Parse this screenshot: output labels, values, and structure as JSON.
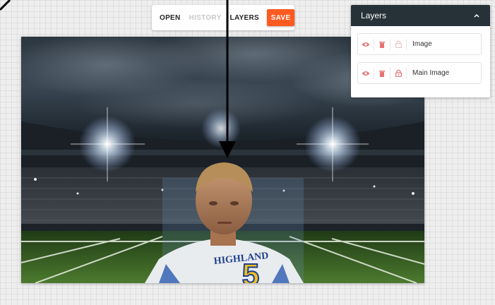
{
  "toolbar": {
    "open": "OPEN",
    "history": "HISTORY",
    "layers": "LAYERS",
    "save": "SAVE"
  },
  "layers_panel": {
    "title": "Layers",
    "items": [
      {
        "name": "Image",
        "visible": true,
        "locked": false,
        "icons": [
          "eye-icon",
          "trash-icon",
          "lock-icon"
        ]
      },
      {
        "name": "Main Image",
        "visible": true,
        "locked": true,
        "icons": [
          "eye-icon",
          "trash-icon",
          "lock-icon"
        ]
      }
    ]
  },
  "canvas": {
    "jersey_text": "HIGHLAND",
    "jersey_number": "5"
  },
  "colors": {
    "save_button": "#ff5a1f",
    "panel_header": "#263238",
    "background": "#eeeeee"
  }
}
